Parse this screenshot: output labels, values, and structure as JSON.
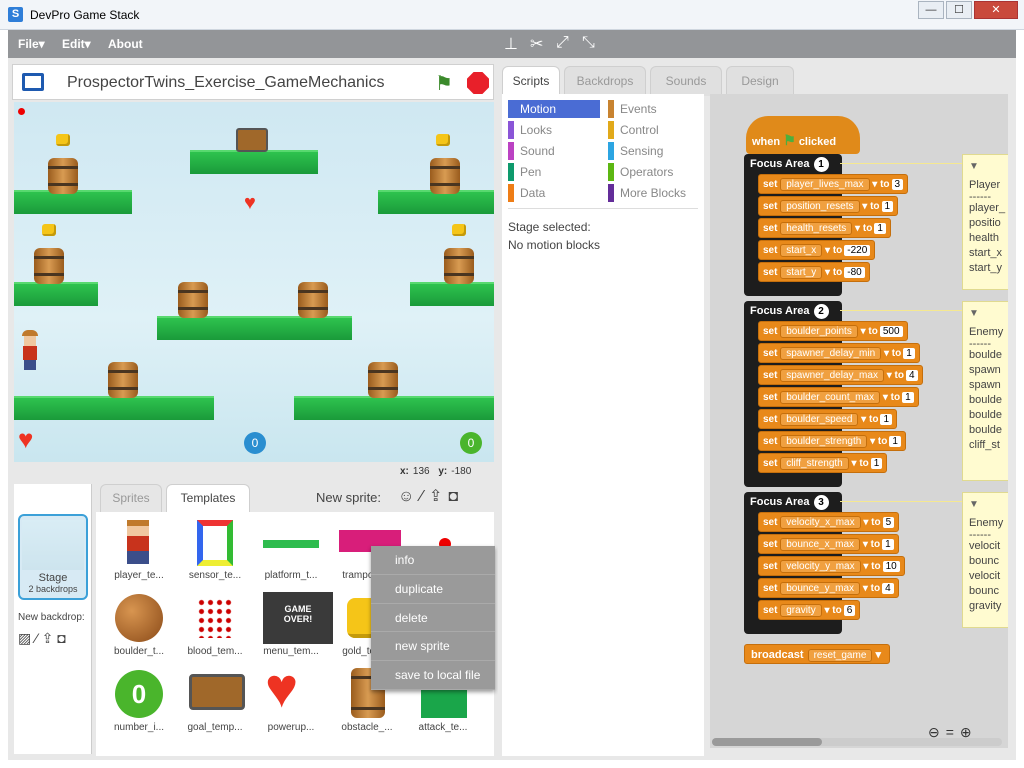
{
  "window": {
    "title": "DevPro Game Stack",
    "minimize": "—",
    "maximize": "☐",
    "close": "✕"
  },
  "menu": {
    "file": "File▾",
    "edit": "Edit▾",
    "about": "About"
  },
  "stage": {
    "project_name": "ProspectorTwins_Exercise_GameMechanics",
    "x_label": "x:",
    "x_value": "136",
    "y_label": "y:",
    "y_value": "-180"
  },
  "sprites": {
    "tabs": [
      "Sprites",
      "Templates"
    ],
    "new_sprite_label": "New sprite:",
    "stage_label": "Stage",
    "stage_backdrops": "2 backdrops",
    "new_backdrop_label": "New backdrop:",
    "items": [
      "player_te...",
      "sensor_te...",
      "platform_t...",
      "trampolin...",
      "",
      "boulder_t...",
      "blood_tem...",
      "menu_tem...",
      "gold_tem...",
      "",
      "number_i...",
      "goal_temp...",
      "powerup...",
      "obstacle_...",
      "attack_te..."
    ]
  },
  "context_menu": [
    "info",
    "duplicate",
    "delete",
    "new sprite",
    "save to local file"
  ],
  "code": {
    "tabs": [
      "Scripts",
      "Backdrops",
      "Sounds",
      "Design"
    ],
    "categories_left": [
      "Motion",
      "Looks",
      "Sound",
      "Pen",
      "Data"
    ],
    "categories_right": [
      "Events",
      "Control",
      "Sensing",
      "Operators",
      "More Blocks"
    ],
    "category_colors": [
      "#4a6cd4",
      "#8a55d7",
      "#bb42c3",
      "#0e9a6c",
      "#ee7d16",
      "#c88330",
      "#e1a91a",
      "#2ca5e2",
      "#5cb712",
      "#632d99"
    ],
    "stage_selected": "Stage selected:",
    "no_motion": "No motion blocks",
    "hat": {
      "when": "when",
      "clicked": "clicked"
    },
    "focus_label": "Focus Area",
    "set_label": "set",
    "to_label": "to",
    "areas": [
      {
        "num": "1",
        "blocks": [
          [
            "player_lives_max",
            "3"
          ],
          [
            "position_resets",
            "1"
          ],
          [
            "health_resets",
            "1"
          ],
          [
            "start_x",
            "-220"
          ],
          [
            "start_y",
            "-80"
          ]
        ]
      },
      {
        "num": "2",
        "blocks": [
          [
            "boulder_points",
            "500"
          ],
          [
            "spawner_delay_min",
            "1"
          ],
          [
            "spawner_delay_max",
            "4"
          ],
          [
            "boulder_count_max",
            "1"
          ],
          [
            "boulder_speed",
            "1"
          ],
          [
            "boulder_strength",
            "1"
          ],
          [
            "cliff_strength",
            "1"
          ]
        ]
      },
      {
        "num": "3",
        "blocks": [
          [
            "velocity_x_max",
            "5"
          ],
          [
            "bounce_x_max",
            "1"
          ],
          [
            "velocity_y_max",
            "10"
          ],
          [
            "bounce_y_max",
            "4"
          ],
          [
            "gravity",
            "6"
          ]
        ]
      }
    ],
    "broadcast": {
      "label": "broadcast",
      "value": "reset_game"
    },
    "notes": [
      {
        "title": "Player",
        "lines": [
          "player_",
          "positio",
          "health",
          "start_x",
          "start_y"
        ]
      },
      {
        "title": "Enemy",
        "lines": [
          "boulde",
          "spawn",
          "spawn",
          "boulde",
          "boulde",
          "boulde",
          "cliff_st"
        ]
      },
      {
        "title": "Enemy",
        "lines": [
          "velocit",
          "bounc",
          "velocit",
          "bounc",
          "gravity"
        ]
      }
    ]
  }
}
